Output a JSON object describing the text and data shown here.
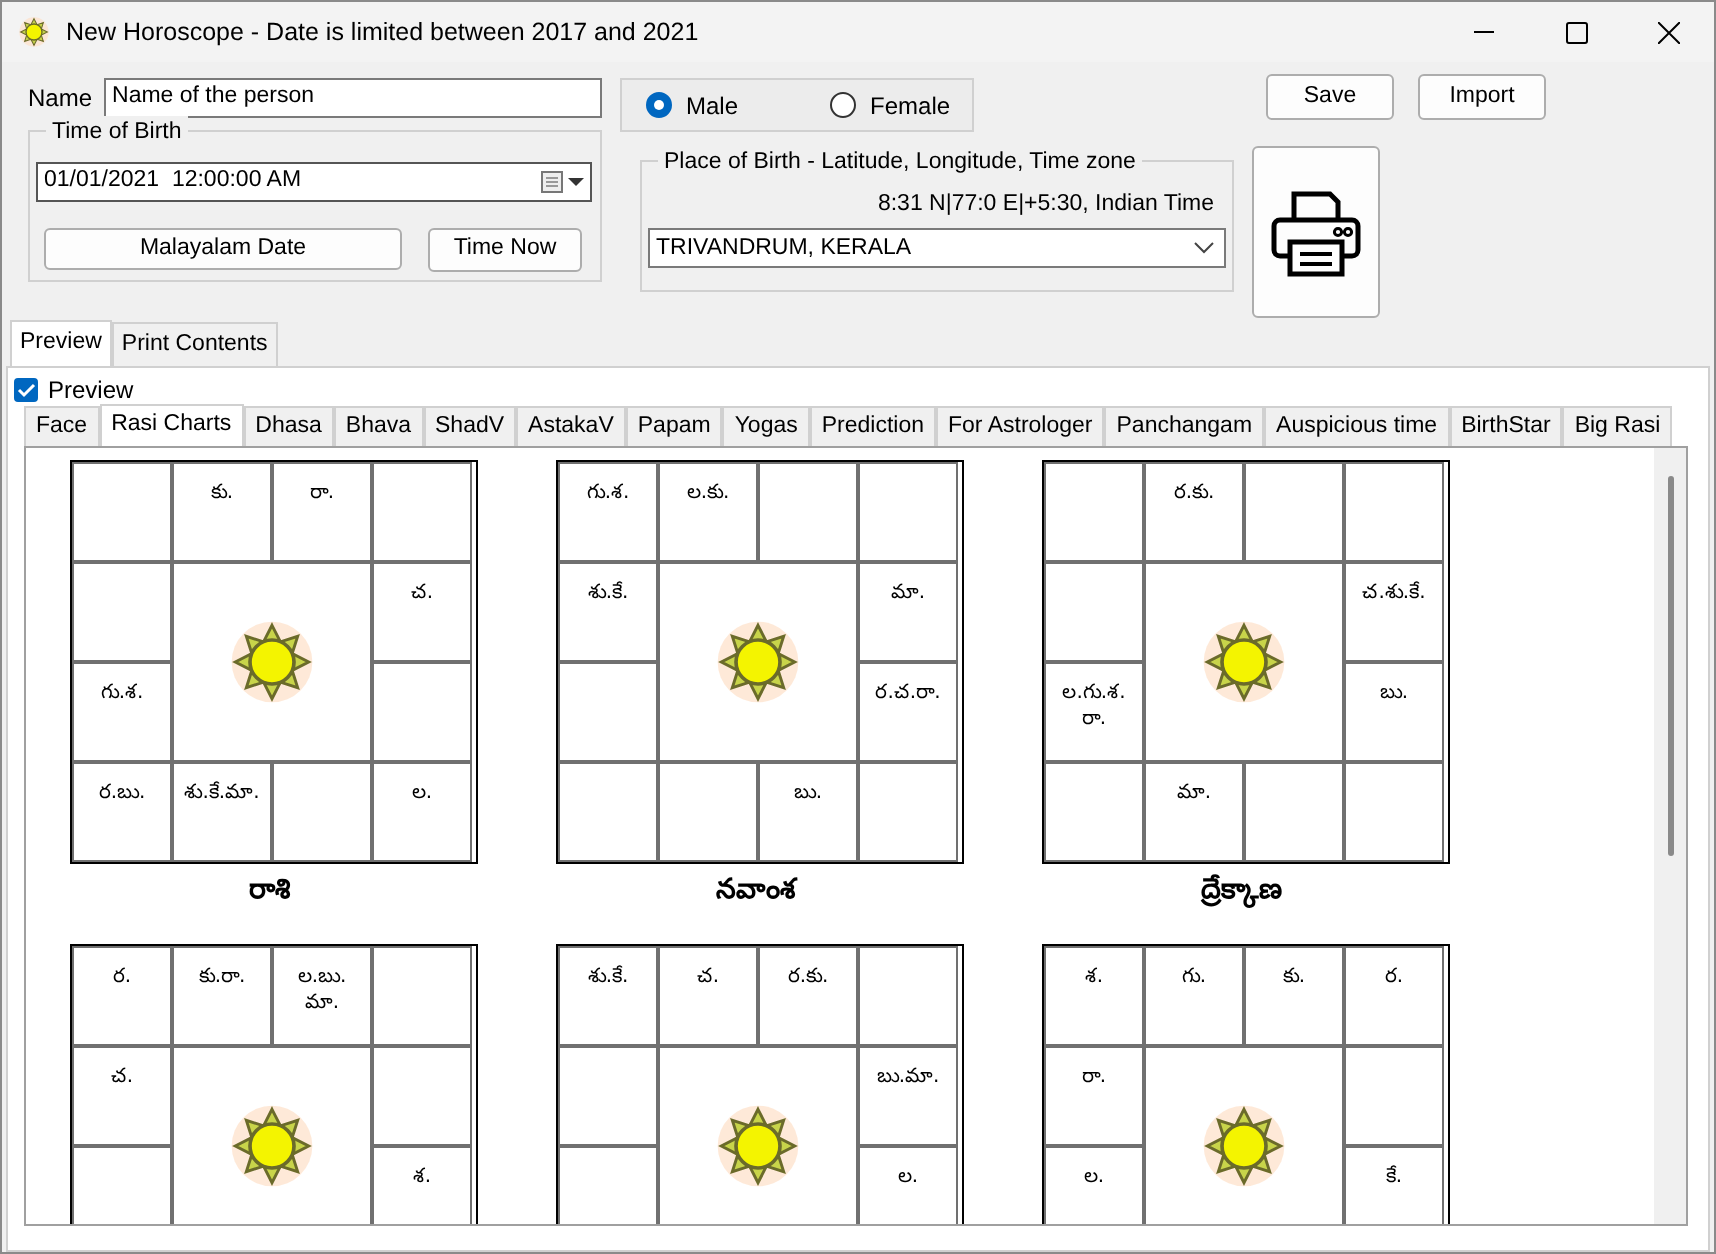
{
  "window": {
    "title": "New Horoscope - Date is limited between 2017 and 2021"
  },
  "name": {
    "label": "Name",
    "value": "Name of the person"
  },
  "gender": [
    {
      "label": "Male",
      "selected": true
    },
    {
      "label": "Female",
      "selected": false
    }
  ],
  "buttons": {
    "save": "Save",
    "import": "Import"
  },
  "time_of_birth": {
    "legend": "Time of Birth",
    "value": "01/01/2021  12:00:00 AM",
    "malayalam_date": "Malayalam Date",
    "time_now": "Time Now"
  },
  "place_of_birth": {
    "legend": "Place of Birth - Latitude, Longitude, Time zone",
    "coordinates": "8:31 N|77:0 E|+5:30, Indian Time",
    "value": "TRIVANDRUM, KERALA"
  },
  "outer_tabs": [
    {
      "label": "Preview",
      "selected": true
    },
    {
      "label": "Print Contents",
      "selected": false
    }
  ],
  "preview_checkbox": {
    "label": "Preview",
    "checked": true
  },
  "tabs": [
    {
      "label": "Face",
      "selected": false
    },
    {
      "label": "Rasi Charts",
      "selected": true
    },
    {
      "label": "Dhasa",
      "selected": false
    },
    {
      "label": "Bhava",
      "selected": false
    },
    {
      "label": "ShadV",
      "selected": false
    },
    {
      "label": "AstakaV",
      "selected": false
    },
    {
      "label": "Papam",
      "selected": false
    },
    {
      "label": "Yogas",
      "selected": false
    },
    {
      "label": "Prediction",
      "selected": false
    },
    {
      "label": "For Astrologer",
      "selected": false
    },
    {
      "label": "Panchangam",
      "selected": false
    },
    {
      "label": "Auspicious time",
      "selected": false
    },
    {
      "label": "BirthStar",
      "selected": false
    },
    {
      "label": "Big Rasi",
      "selected": false
    }
  ],
  "charts": [
    {
      "title": "రాశి",
      "cells": {
        "top_2": "కు.",
        "top_3": "రా.",
        "left_2": "గు.శ.",
        "right_1": "చ.",
        "bottom_1": "ర.బు.",
        "bottom_2": "శు.కే.మా.",
        "bottom_4": "ల."
      }
    },
    {
      "title": "నవాంశ",
      "cells": {
        "top_1": "గు.శ.",
        "top_2": "ల.కు.",
        "left_1": "శు.కే.",
        "right_1": "మా.",
        "right_2": "ర.చ.రా.",
        "bottom_3": "బు."
      }
    },
    {
      "title": "ద్రేక్కాణ",
      "cells": {
        "top_2": "ర.కు.",
        "left_2": "ల.గు.శ. రా.",
        "right_1": "చ.శు.కే.",
        "right_2": "బు.",
        "bottom_2": "మా."
      }
    },
    {
      "cells": {
        "top_1": "ర.",
        "top_2": "కు.రా.",
        "top_3": "ల.బు. మా.",
        "left_1": "చ.",
        "right_2": "శ."
      }
    },
    {
      "cells": {
        "top_1": "శు.కే.",
        "top_2": "చ.",
        "top_3": "ర.కు.",
        "right_1": "బు.మా.",
        "right_2": "ల."
      }
    },
    {
      "cells": {
        "top_1": "శ.",
        "top_2": "గు.",
        "top_3": "కు.",
        "top_4": "ర.",
        "left_1": "రా.",
        "left_2": "ల.",
        "right_2": "కే."
      }
    }
  ]
}
